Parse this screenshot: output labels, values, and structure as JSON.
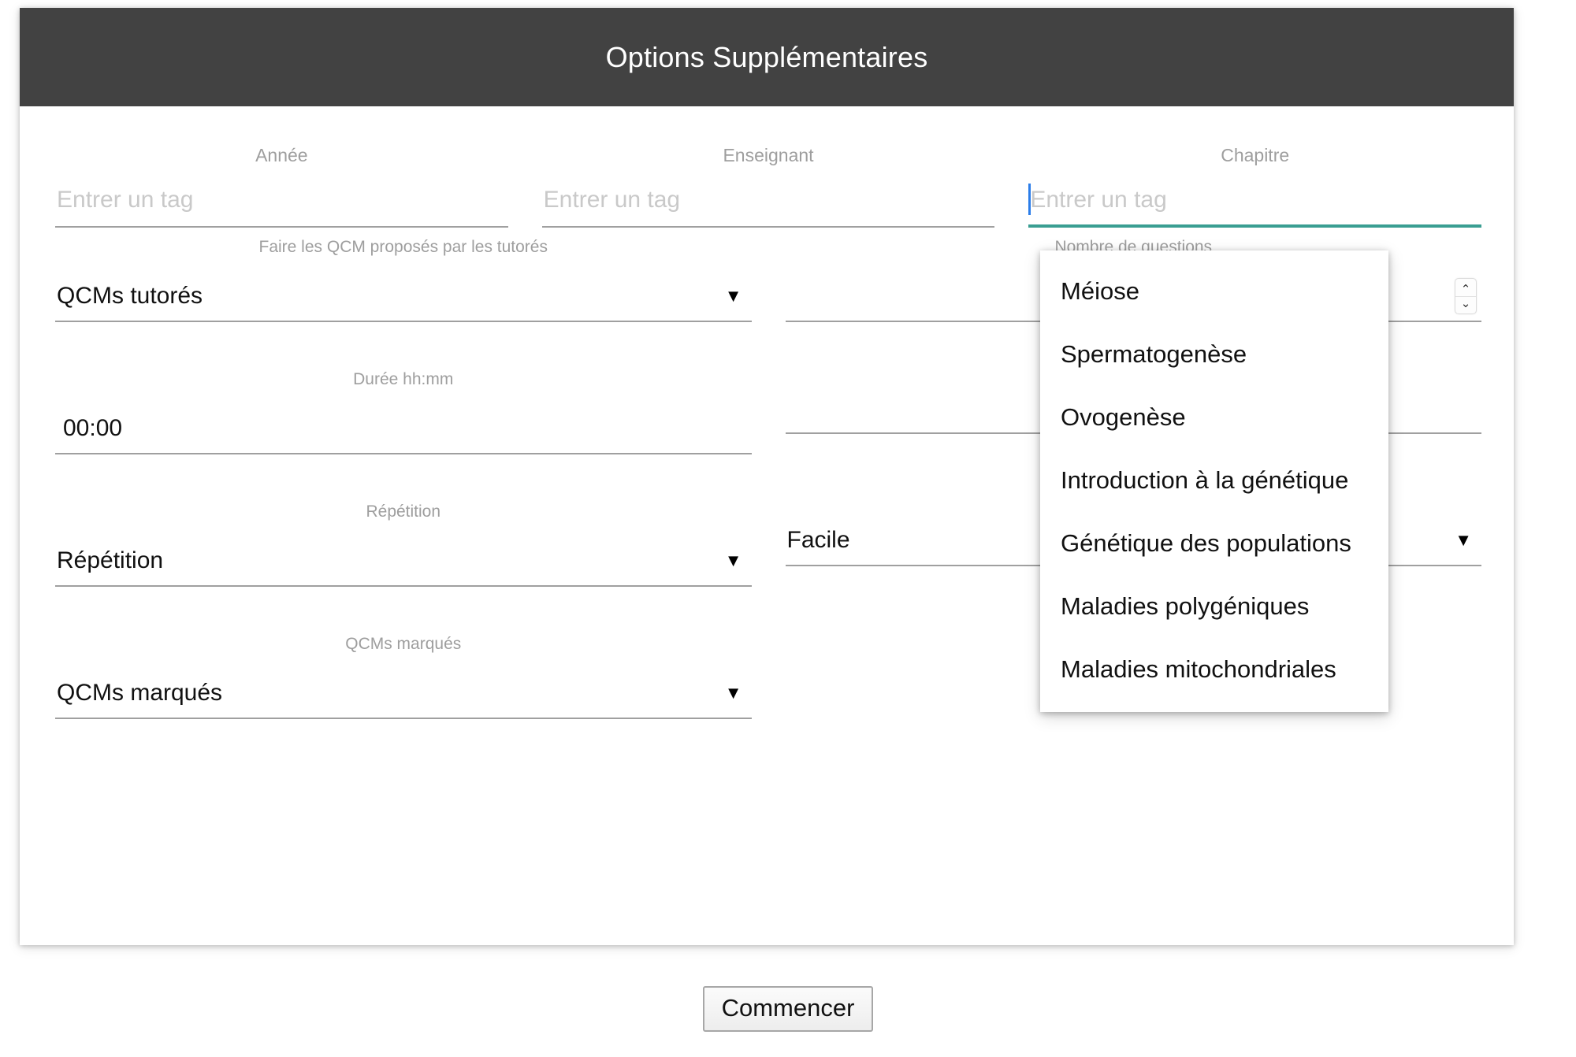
{
  "dialog": {
    "title": "Options Supplémentaires",
    "accent_color": "#3a9e92",
    "header_color": "#424242"
  },
  "tag_fields": [
    {
      "label": "Année",
      "value": "",
      "placeholder": "Entrer un tag",
      "focused": false
    },
    {
      "label": "Enseignant",
      "value": "",
      "placeholder": "Entrer un tag",
      "focused": false
    },
    {
      "label": "Chapitre",
      "value": "",
      "placeholder": "Entrer un tag",
      "focused": true
    }
  ],
  "fields": {
    "tutored_qcm": {
      "label": "Faire les QCM proposés par les tutorés",
      "value": "QCMs tutorés"
    },
    "question_count": {
      "label": "Nombre de questions",
      "value": ""
    },
    "duration": {
      "label": "Durée hh:mm",
      "value": "00:00"
    },
    "repetition": {
      "label": "Répétition",
      "value": "Répétition"
    },
    "difficulty": {
      "label": "",
      "value": "Facile"
    },
    "marked_qcm": {
      "label": "QCMs marqués",
      "value": "QCMs marqués"
    }
  },
  "dropdown": {
    "items": [
      "Méiose",
      "Spermatogenèse",
      "Ovogenèse",
      "Introduction à la génétique",
      "Génétique des populations",
      "Maladies polygéniques",
      "Maladies mitochondriales"
    ]
  },
  "footer": {
    "start_label": "Commencer"
  },
  "icons": {
    "dropdown_arrow": "▼",
    "spinner_up": "⌃",
    "spinner_down": "⌄"
  }
}
